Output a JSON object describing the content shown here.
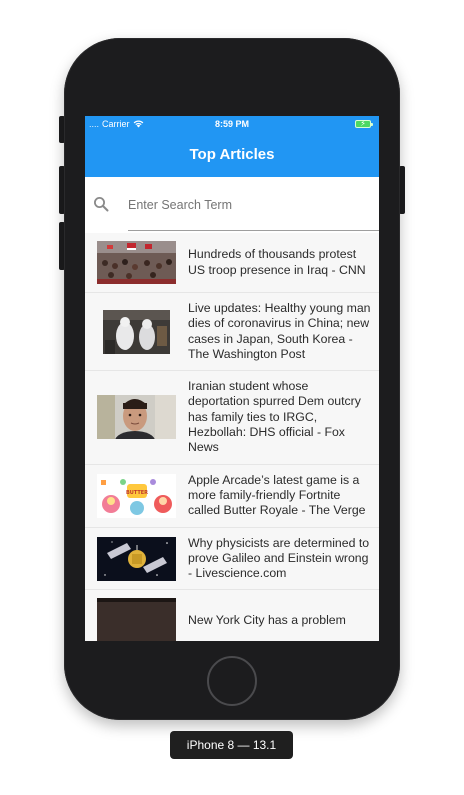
{
  "status_bar": {
    "signal": "....",
    "carrier": "Carrier",
    "time": "8:59 PM",
    "wifi_icon": "wifi-icon",
    "battery_icon": "battery-charging-icon"
  },
  "header": {
    "title": "Top Articles",
    "color": "#2196f3"
  },
  "search": {
    "placeholder": "Enter Search Term",
    "icon": "search-icon"
  },
  "articles": [
    {
      "title": "Hundreds of thousands protest US troop presence in Iraq - CNN",
      "image": "crowd-protest-photo"
    },
    {
      "title": "Live updates: Healthy young man dies of coronavirus in China; new cases in Japan, South Korea - The Washington Post",
      "image": "hazmat-workers-photo"
    },
    {
      "title": "Iranian student whose deportation spurred Dem outcry has family ties to IRGC, Hezbollah: DHS official - Fox News",
      "image": "student-portrait-photo"
    },
    {
      "title": "Apple Arcade’s latest game is a more family-friendly Fortnite called Butter Royale - The Verge",
      "image": "butter-royale-game-art"
    },
    {
      "title": "Why physicists are determined to prove Galileo and Einstein wrong - Livescience.com",
      "image": "satellite-in-space-photo"
    },
    {
      "title": "New York City has a problem",
      "image": "partially-visible-photo"
    }
  ],
  "device_label": "iPhone 8 — 13.1"
}
